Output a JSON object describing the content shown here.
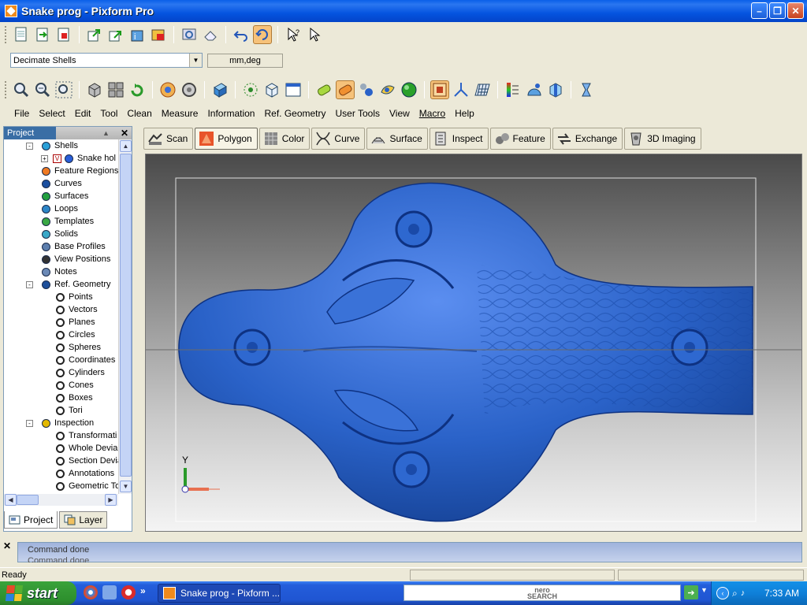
{
  "window": {
    "title": "Snake prog - Pixform Pro"
  },
  "command": {
    "selected": "Decimate Shells",
    "units": "mm,deg"
  },
  "menu": [
    "File",
    "Select",
    "Edit",
    "Tool",
    "Clean",
    "Measure",
    "Information",
    "Ref. Geometry",
    "User Tools",
    "View",
    "Macro",
    "Help"
  ],
  "panel": {
    "title": "Project",
    "tree": [
      {
        "label": "Shells",
        "indent": 0,
        "expand": "-",
        "icon": "#2aa0d8"
      },
      {
        "label": "Snake hol",
        "indent": 1,
        "expand": "+",
        "icon": "#2a5ed8",
        "check": "V"
      },
      {
        "label": "Feature Regions",
        "indent": 0,
        "icon": "#f07a22"
      },
      {
        "label": "Curves",
        "indent": 0,
        "icon": "#1b4fa0"
      },
      {
        "label": "Surfaces",
        "indent": 0,
        "icon": "#23a040"
      },
      {
        "label": "Loops",
        "indent": 0,
        "icon": "#2d86c8"
      },
      {
        "label": "Templates",
        "indent": 0,
        "icon": "#3aa844"
      },
      {
        "label": "Solids",
        "indent": 0,
        "icon": "#3aa8c8"
      },
      {
        "label": "Base Profiles",
        "indent": 0,
        "icon": "#5d7fae"
      },
      {
        "label": "View Positions",
        "indent": 0,
        "icon": "#333333"
      },
      {
        "label": "Notes",
        "indent": 0,
        "icon": "#6b89b6"
      },
      {
        "label": "Ref. Geometry",
        "indent": 0,
        "expand": "-",
        "icon": "#1e4f9a"
      },
      {
        "label": "Points",
        "indent": 1,
        "icon": "#ffffff"
      },
      {
        "label": "Vectors",
        "indent": 1,
        "icon": "#ffffff"
      },
      {
        "label": "Planes",
        "indent": 1,
        "icon": "#ffffff"
      },
      {
        "label": "Circles",
        "indent": 1,
        "icon": "#ffffff"
      },
      {
        "label": "Spheres",
        "indent": 1,
        "icon": "#ffffff"
      },
      {
        "label": "Coordinates",
        "indent": 1,
        "icon": "#ffffff"
      },
      {
        "label": "Cylinders",
        "indent": 1,
        "icon": "#ffffff"
      },
      {
        "label": "Cones",
        "indent": 1,
        "icon": "#ffffff"
      },
      {
        "label": "Boxes",
        "indent": 1,
        "icon": "#ffffff"
      },
      {
        "label": "Tori",
        "indent": 1,
        "icon": "#ffffff"
      },
      {
        "label": "Inspection",
        "indent": 0,
        "expand": "-",
        "icon": "#e2b800"
      },
      {
        "label": "Transformati",
        "indent": 1,
        "icon": "#ffffff"
      },
      {
        "label": "Whole Devial",
        "indent": 1,
        "icon": "#ffffff"
      },
      {
        "label": "Section Devia",
        "indent": 1,
        "icon": "#ffffff"
      },
      {
        "label": "Annotations",
        "indent": 1,
        "icon": "#ffffff"
      },
      {
        "label": "Geometric To",
        "indent": 1,
        "icon": "#ffffff"
      }
    ],
    "tabs": [
      "Project",
      "Layer"
    ]
  },
  "modes": [
    "Scan",
    "Polygon",
    "Color",
    "Curve",
    "Surface",
    "Inspect",
    "Feature",
    "Exchange",
    "3D Imaging"
  ],
  "active_mode": "Polygon",
  "viewport": {
    "axis_label": "Y",
    "model_color": "#2a62c8"
  },
  "output": {
    "line1": "Command done",
    "line2": "Command done"
  },
  "status": {
    "text": "Ready"
  },
  "taskbar": {
    "start": "start",
    "task": "Snake prog - Pixform ...",
    "search_brand": "nero",
    "search_sub": "SEARCH",
    "clock": "7:33 AM"
  },
  "colors": {
    "title_bar": "#0a5fe8",
    "start_green": "#3aa43a",
    "active_tab": "#f6c27a",
    "model_blue": "#2a62c8"
  }
}
